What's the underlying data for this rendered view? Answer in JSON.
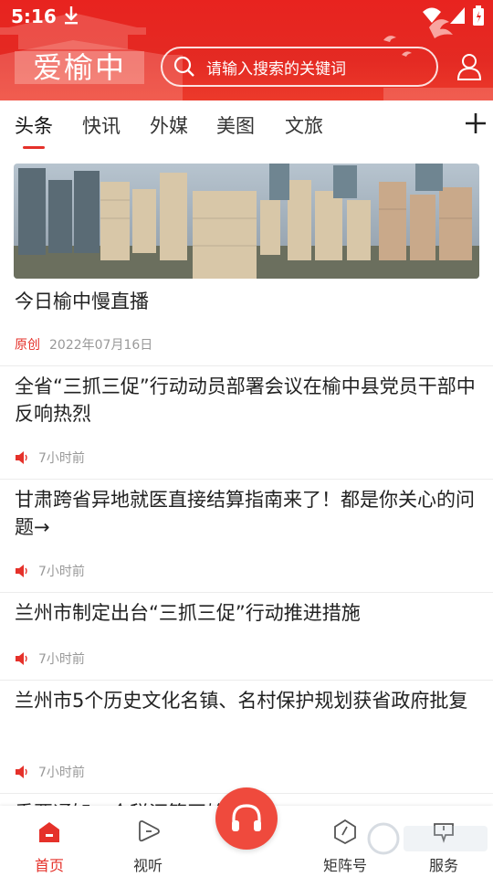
{
  "status_bar": {
    "time": "5:16"
  },
  "header": {
    "logo": "爱榆中",
    "search_placeholder": "请输入搜索的关键词"
  },
  "tabs": [
    {
      "label": "头条",
      "active": true
    },
    {
      "label": "快讯"
    },
    {
      "label": "外媒"
    },
    {
      "label": "美图"
    },
    {
      "label": "文旅"
    }
  ],
  "feed": {
    "hero": {
      "title": "今日榆中慢直播",
      "badge": "原创",
      "date": "2022年07月16日"
    },
    "items": [
      {
        "title": "全省“三抓三促”行动动员部署会议在榆中县党员干部中反响热烈",
        "time": "7小时前"
      },
      {
        "title": "甘肃跨省异地就医直接结算指南来了！都是你关心的问题→",
        "time": "7小时前"
      },
      {
        "title": "兰州市制定出台“三抓三促”行动推进措施",
        "time": "7小时前"
      },
      {
        "title": "兰州市5个历史文化名镇、名村保护规划获省政府批复",
        "time": "7小时前"
      }
    ],
    "peek_title": "重要通知：个税汇算开始了！"
  },
  "bottom_nav": [
    {
      "label": "首页",
      "active": true
    },
    {
      "label": "视听"
    },
    {
      "label": "矩阵号"
    },
    {
      "label": "服务"
    }
  ],
  "colors": {
    "brand_red": "#e5312a",
    "header_red": "#e8231f"
  },
  "icons": [
    "download-icon",
    "wifi-icon",
    "signal-icon",
    "battery-icon",
    "search-icon",
    "user-icon",
    "plus-icon",
    "speaker-icon",
    "home-icon",
    "play-icon",
    "headset-icon",
    "compass-icon",
    "service-icon"
  ]
}
